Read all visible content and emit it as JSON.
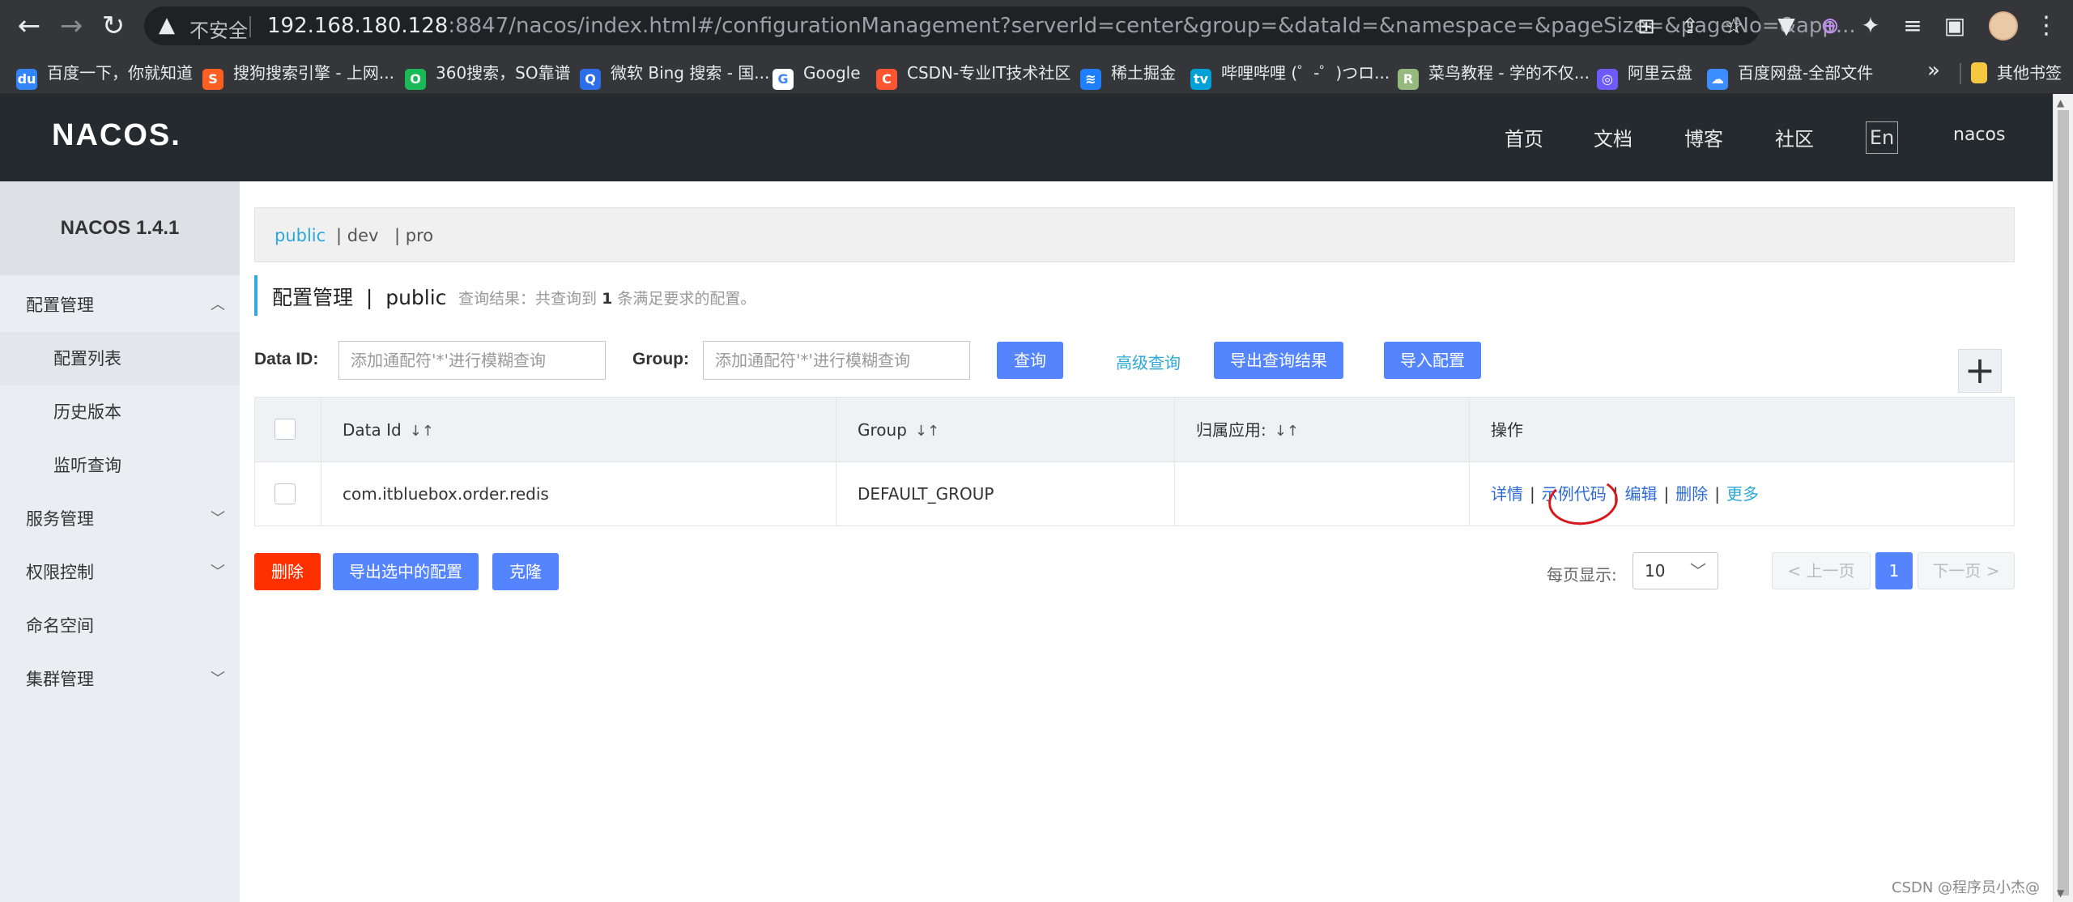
{
  "browser": {
    "insecure_label": "不安全",
    "url_host": "192.168.180.128",
    "url_rest": ":8847/nacos/index.html#/configurationManagement?serverId=center&group=&dataId=&namespace=&pageSize=&pageNo=&app..."
  },
  "bookmarks": [
    {
      "label": "百度一下，你就知道",
      "icon_color": "#3385ff",
      "icon": "du"
    },
    {
      "label": "搜狗搜索引擎 - 上网...",
      "icon_color": "#fb6022",
      "icon": "S"
    },
    {
      "label": "360搜索，SO靠谱",
      "icon_color": "#19b955",
      "icon": "O"
    },
    {
      "label": "微软 Bing 搜索 - 国...",
      "icon_color": "#2b6ee8",
      "icon": "Q"
    },
    {
      "label": "Google",
      "icon_color": "#ffffff",
      "icon": "G"
    },
    {
      "label": "CSDN-专业IT技术社区",
      "icon_color": "#fc5531",
      "icon": "C"
    },
    {
      "label": "稀土掘金",
      "icon_color": "#1e80ff",
      "icon": "≋"
    },
    {
      "label": "哔哩哔哩 (゜-゜)つロ...",
      "icon_color": "#00a1d6",
      "icon": "tv"
    },
    {
      "label": "菜鸟教程 - 学的不仅...",
      "icon_color": "#96b97d",
      "icon": "R"
    },
    {
      "label": "阿里云盘",
      "icon_color": "#6e5bff",
      "icon": "◎"
    },
    {
      "label": "百度网盘-全部文件",
      "icon_color": "#3c8dff",
      "icon": "☁"
    }
  ],
  "bookmarks_other": "其他书签",
  "header": {
    "logo": "NACOS.",
    "nav": [
      "首页",
      "文档",
      "博客",
      "社区"
    ],
    "lang": "En",
    "user": "nacos"
  },
  "sidebar": {
    "title": "NACOS 1.4.1",
    "items": [
      {
        "label": "配置管理",
        "chev": "︿"
      },
      {
        "label": "配置列表"
      },
      {
        "label": "历史版本"
      },
      {
        "label": "监听查询"
      },
      {
        "label": "服务管理",
        "chev": "﹀"
      },
      {
        "label": "权限控制",
        "chev": "﹀"
      },
      {
        "label": "命名空间"
      },
      {
        "label": "集群管理",
        "chev": "﹀"
      }
    ]
  },
  "namespaces": [
    "public",
    "| dev",
    "| pro"
  ],
  "page": {
    "title": "配置管理  |  public",
    "query_prefix": "查询结果：共查询到",
    "query_count": "1",
    "query_suffix": "条满足要求的配置。"
  },
  "filters": {
    "data_id_label": "Data ID:",
    "data_id_placeholder": "添加通配符'*'进行模糊查询",
    "group_label": "Group:",
    "group_placeholder": "添加通配符'*'进行模糊查询",
    "query_btn": "查询",
    "advanced_query": "高级查询",
    "export_results": "导出查询结果",
    "import_config": "导入配置",
    "add_btn": "+"
  },
  "table": {
    "columns": [
      "Data Id",
      "Group",
      "归属应用:",
      "操作"
    ],
    "sort_icon": "↓↑",
    "rows": [
      {
        "data_id": "com.itbluebox.order.redis",
        "group": "DEFAULT_GROUP",
        "app": "",
        "ops": [
          "详情",
          "示例代码",
          "编辑",
          "删除",
          "更多"
        ]
      }
    ]
  },
  "actions": {
    "delete": "删除",
    "export_selected": "导出选中的配置",
    "clone": "克隆"
  },
  "pagination": {
    "page_size_label": "每页显示:",
    "page_size": "10",
    "prev": "< 上一页",
    "current": "1",
    "next": "下一页 >"
  },
  "watermark": "CSDN @程序员小杰@"
}
